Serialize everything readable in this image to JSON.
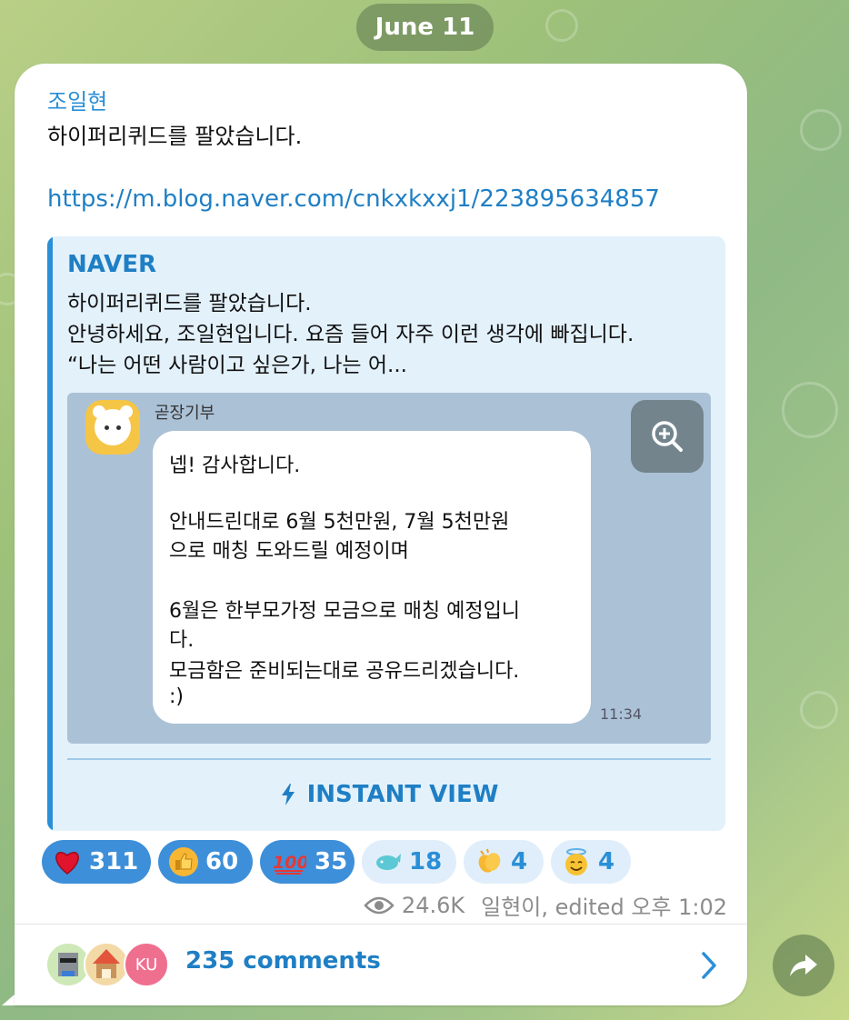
{
  "date_pill": "June 11",
  "post": {
    "author": "조일현",
    "text": "하이퍼리퀴드를 팔았습니다.",
    "link": "https://m.blog.naver.com/cnkxkxxj1/223895634857"
  },
  "preview": {
    "site": "NAVER",
    "title": "하이퍼리퀴드를 팔았습니다.",
    "desc_lines": [
      "안녕하세요, 조일현입니다. 요즘 들어 자주 이런 생각에 빠집니다.",
      "“나는 어떤 사람이고 싶은가, 나는 어..."
    ],
    "screenshot": {
      "sender": "곧장기부",
      "lines": [
        "넵! 감사합니다.",
        "",
        "안내드린대로 6월 5천만원, 7월 5천만원",
        "으로 매칭 도와드릴 예정이며",
        "",
        "6월은 한부모가정 모금으로 매칭 예정입니",
        "다.",
        "모금함은 준비되는대로 공유드리겠습니다.",
        ":)"
      ],
      "time": "11:34"
    },
    "instant_view": "INSTANT VIEW"
  },
  "reactions": [
    {
      "emoji": "red-heart",
      "count": "311",
      "active": true,
      "color": "#e0142c"
    },
    {
      "emoji": "thumbs-up",
      "count": "60",
      "active": true,
      "color": "#f7b733"
    },
    {
      "emoji": "hundred-points",
      "count": "35",
      "active": true,
      "color": "#e53935"
    },
    {
      "emoji": "whale",
      "count": "18",
      "active": false,
      "color": "#5bc8d4"
    },
    {
      "emoji": "clapping-hands",
      "count": "4",
      "active": false,
      "color": "#f7b733"
    },
    {
      "emoji": "smiling-face-with-halo",
      "count": "4",
      "active": false,
      "color": "#f7c233"
    }
  ],
  "meta": {
    "views": "24.6K",
    "signature": "일현이, edited 오후 1:02"
  },
  "comments": {
    "count_label": "235 comments",
    "avatar_initials": "KU"
  },
  "colors": {
    "accent": "#2a8fd6",
    "reaction_active": "#3d8fd9",
    "reaction_idle": "#dfeefa"
  }
}
